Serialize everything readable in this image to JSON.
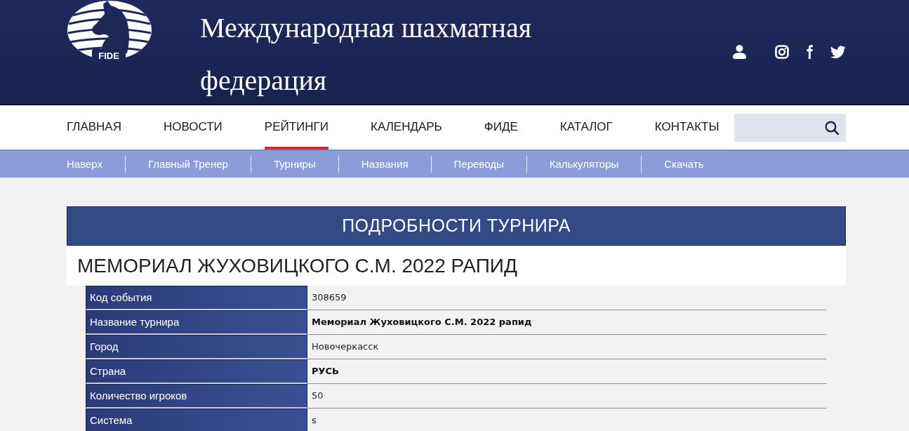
{
  "header": {
    "logo_text": "FIDE",
    "title_lines": [
      "Международная шахматная",
      "федерация"
    ]
  },
  "main_nav": [
    {
      "label": "ГЛАВНАЯ",
      "selected": false
    },
    {
      "label": "НОВОСТИ",
      "selected": false
    },
    {
      "label": "РЕЙТИНГИ",
      "selected": true
    },
    {
      "label": "КАЛЕНДАРЬ",
      "selected": false
    },
    {
      "label": "ФИДЕ",
      "selected": false
    },
    {
      "label": "КАТАЛОГ",
      "selected": false
    },
    {
      "label": "КОНТАКТЫ",
      "selected": false
    }
  ],
  "sub_nav": [
    "Наверх",
    "Главный Тренер",
    "Турниры",
    "Названия",
    "Переводы",
    "Калькуляторы",
    "Скачать"
  ],
  "section_title": "ПОДРОБНОСТИ ТУРНИРА",
  "tournament_title": "МЕМОРИАЛ ЖУХОВИЦКОГО С.М. 2022 РАПИД",
  "details": [
    {
      "label": "Код события",
      "value": "308659",
      "bold": false
    },
    {
      "label": "Название турнира",
      "value": "Мемориал Жуховицкого С.М. 2022 рапид",
      "bold": true
    },
    {
      "label": "Город",
      "value": "Новочеркасск",
      "bold": false
    },
    {
      "label": "Страна",
      "value": "РУСЬ",
      "bold": true
    },
    {
      "label": "Количество игроков",
      "value": "50",
      "bold": false
    },
    {
      "label": "Система",
      "value": "s",
      "bold": false
    }
  ]
}
